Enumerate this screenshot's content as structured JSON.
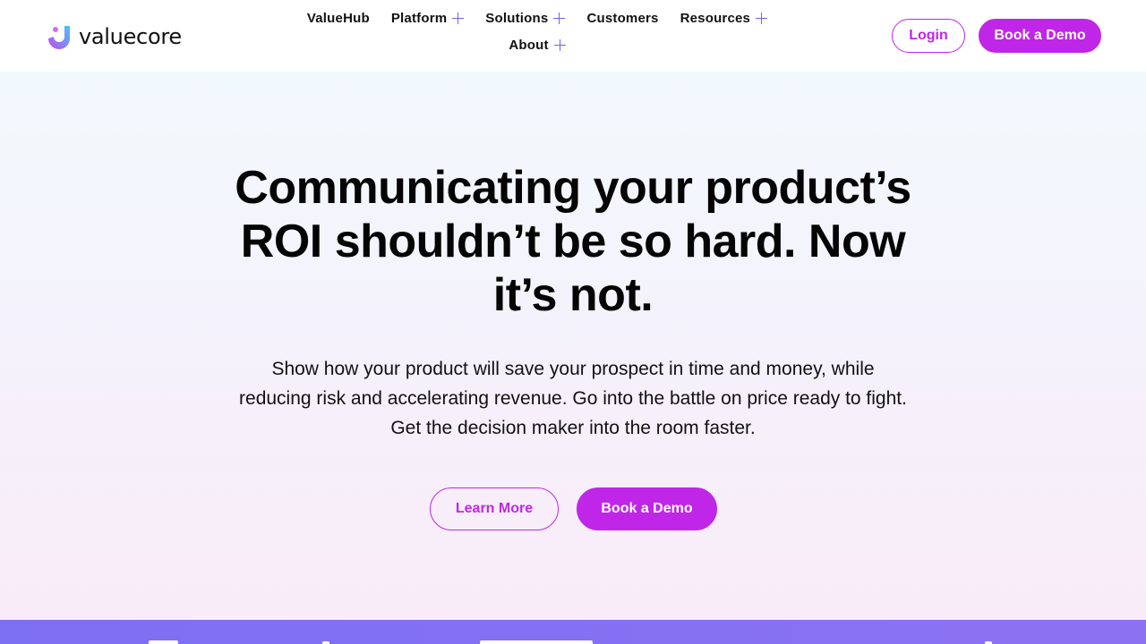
{
  "brand": {
    "name": "valuecore",
    "colors": {
      "accent": "#c026e8",
      "logo_gradient_start": "#c04bf0",
      "logo_gradient_end": "#4cc3f7",
      "band": "#8471f3"
    }
  },
  "nav": {
    "items": [
      {
        "label": "ValueHub",
        "has_submenu": false
      },
      {
        "label": "Platform",
        "has_submenu": true,
        "icon": "plus-icon"
      },
      {
        "label": "Solutions",
        "has_submenu": true,
        "icon": "plus-icon"
      },
      {
        "label": "Customers",
        "has_submenu": false
      },
      {
        "label": "Resources",
        "has_submenu": true,
        "icon": "plus-icon"
      },
      {
        "label": "About",
        "has_submenu": true,
        "icon": "plus-icon"
      }
    ]
  },
  "header": {
    "login_label": "Login",
    "demo_label": "Book a Demo"
  },
  "hero": {
    "title": "Communicating your product’s ROI shouldn’t be so hard. Now it’s not.",
    "subtitle": "Show how your product will save your prospect in time and money, while reducing risk and accelerating revenue. Go into the battle on price ready to fight. Get the decision maker into the room faster.",
    "learn_more_label": "Learn More",
    "demo_label": "Book a Demo"
  }
}
